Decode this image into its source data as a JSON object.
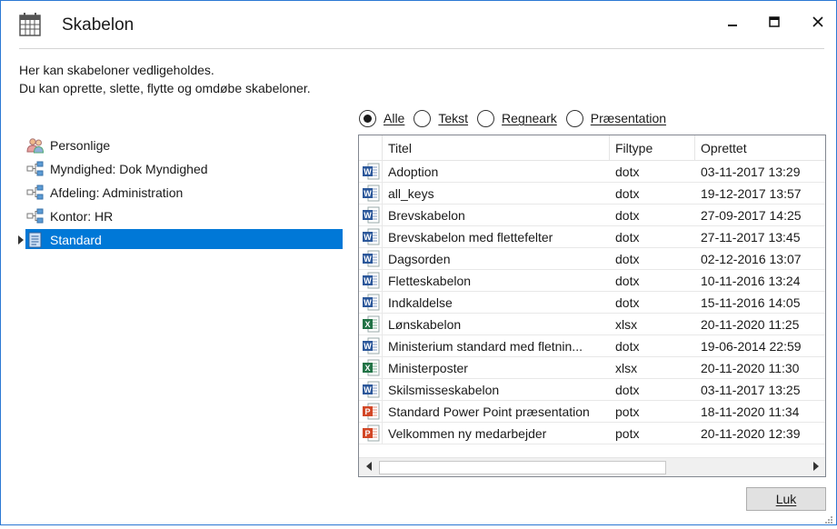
{
  "window": {
    "title": "Skabelon",
    "controls": [
      "minimize",
      "maximize",
      "close"
    ]
  },
  "description": {
    "line1": "Her kan skabeloner vedligeholdes.",
    "line2": "Du kan oprette, slette, flytte og omdøbe skabeloner."
  },
  "tree": {
    "items": [
      {
        "label": "Personlige",
        "icon": "users-icon",
        "selected": false
      },
      {
        "label": "Myndighed: Dok Myndighed",
        "icon": "org-chart-icon",
        "selected": false
      },
      {
        "label": "Afdeling: Administration",
        "icon": "org-chart-icon",
        "selected": false
      },
      {
        "label": "Kontor: HR",
        "icon": "org-chart-icon",
        "selected": false
      },
      {
        "label": "Standard",
        "icon": "document-icon",
        "selected": true
      }
    ]
  },
  "filters": {
    "options": [
      {
        "label": "Alle",
        "checked": true
      },
      {
        "label": "Tekst",
        "checked": false
      },
      {
        "label": "Regneark",
        "checked": false
      },
      {
        "label": "Præsentation",
        "checked": false
      }
    ]
  },
  "table": {
    "columns": [
      "Titel",
      "Filtype",
      "Oprettet"
    ],
    "rows": [
      {
        "kind": "word",
        "title": "Adoption",
        "type": "dotx",
        "created": "03-11-2017 13:29"
      },
      {
        "kind": "word",
        "title": "all_keys",
        "type": "dotx",
        "created": "19-12-2017 13:57"
      },
      {
        "kind": "word",
        "title": "Brevskabelon",
        "type": "dotx",
        "created": "27-09-2017 14:25"
      },
      {
        "kind": "word",
        "title": "Brevskabelon med flettefelter",
        "type": "dotx",
        "created": "27-11-2017 13:45"
      },
      {
        "kind": "word",
        "title": "Dagsorden",
        "type": "dotx",
        "created": "02-12-2016 13:07"
      },
      {
        "kind": "word",
        "title": "Fletteskabelon",
        "type": "dotx",
        "created": "10-11-2016 13:24"
      },
      {
        "kind": "word",
        "title": "Indkaldelse",
        "type": "dotx",
        "created": "15-11-2016 14:05"
      },
      {
        "kind": "excel",
        "title": "Lønskabelon",
        "type": "xlsx",
        "created": "20-11-2020 11:25"
      },
      {
        "kind": "word",
        "title": "Ministerium standard med fletnin...",
        "type": "dotx",
        "created": "19-06-2014 22:59"
      },
      {
        "kind": "excel",
        "title": "Ministerposter",
        "type": "xlsx",
        "created": "20-11-2020 11:30"
      },
      {
        "kind": "word",
        "title": "Skilsmisseskabelon",
        "type": "dotx",
        "created": "03-11-2017 13:25"
      },
      {
        "kind": "powerpoint",
        "title": "Standard Power Point præsentation",
        "type": "potx",
        "created": "18-11-2020 11:34"
      },
      {
        "kind": "powerpoint",
        "title": "Velkommen ny medarbejder",
        "type": "potx",
        "created": "20-11-2020 12:39"
      }
    ]
  },
  "footer": {
    "close_label": "Luk"
  },
  "colors": {
    "accent": "#0078d7",
    "word": "#2b579a",
    "excel": "#217346",
    "powerpoint": "#d24726"
  }
}
